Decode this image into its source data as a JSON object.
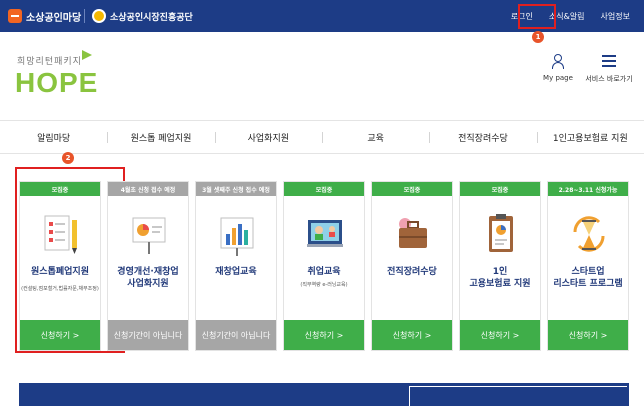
{
  "topbar": {
    "logo1": "소상공인마당",
    "logo2": "소상공인시장진흥공단",
    "links": [
      "로그인",
      "소식&알림",
      "사업정보"
    ]
  },
  "badges": [
    "1",
    "2"
  ],
  "header": {
    "brand_small": "희망리턴패키지",
    "brand_big": "HOPE",
    "mypage": "My page",
    "sitemap": "서비스 바로가기"
  },
  "nav": [
    "알림마당",
    "원스톱 폐업지원",
    "사업화지원",
    "교육",
    "전직장려수당",
    "1인고용보험료 지원"
  ],
  "cards": [
    {
      "tag": "모집중",
      "status": "green",
      "title": "원스톱폐업지원",
      "sub": "(컨설팅,점포철거,법률자문,채무조정)",
      "button": "신청하기 >",
      "illus": "checklist"
    },
    {
      "tag": "4월초 신청 접수 예정",
      "status": "gray",
      "title": "경영개선·재창업\n사업화지원",
      "sub": "",
      "button": "신청기간이 아닙니다",
      "illus": "presentation"
    },
    {
      "tag": "3월 셋째주 신청 접수 예정",
      "status": "gray",
      "title": "재창업교육",
      "sub": "",
      "button": "신청기간이 아닙니다",
      "illus": "bar-chart"
    },
    {
      "tag": "모집중",
      "status": "green",
      "title": "취업교육",
      "sub": "(직무역량 e-러닝교육)",
      "button": "신청하기 >",
      "illus": "video-call"
    },
    {
      "tag": "모집중",
      "status": "green",
      "title": "전직장려수당",
      "sub": "",
      "button": "신청하기 >",
      "illus": "briefcase"
    },
    {
      "tag": "모집중",
      "status": "green",
      "title": "1인\n고용보험료 지원",
      "sub": "",
      "button": "신청하기 >",
      "illus": "clipboard"
    },
    {
      "tag": "2.28~3.11 신청가능",
      "status": "green",
      "title": "스타트업\n리스타트 프로그램",
      "sub": "",
      "button": "신청하기 >",
      "illus": "hourglass"
    }
  ],
  "colors": {
    "navy": "#1d3c86",
    "green": "#3fae49",
    "gray": "#a6a6a6",
    "highlight": "#e02020",
    "brand": "#8ac43f"
  }
}
